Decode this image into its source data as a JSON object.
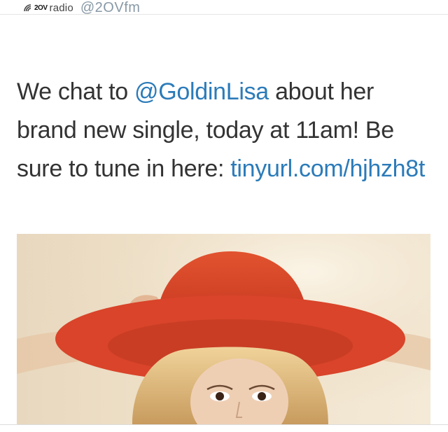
{
  "header": {
    "logo_badge": "2OV",
    "logo_word": "radio",
    "handle": "@2OVfm"
  },
  "tweet": {
    "part1": "We chat to ",
    "mention": "@GoldinLisa",
    "part2": " about her brand new single, today at 11am! Be sure to tune in here: ",
    "link": "tinyurl.com/hjhzh8t"
  },
  "colors": {
    "link": "#2b7bb9",
    "text": "#333333",
    "handle": "#8899a6",
    "hat": "#d9442a"
  },
  "icons": {
    "logo": "radio-wave-icon"
  }
}
